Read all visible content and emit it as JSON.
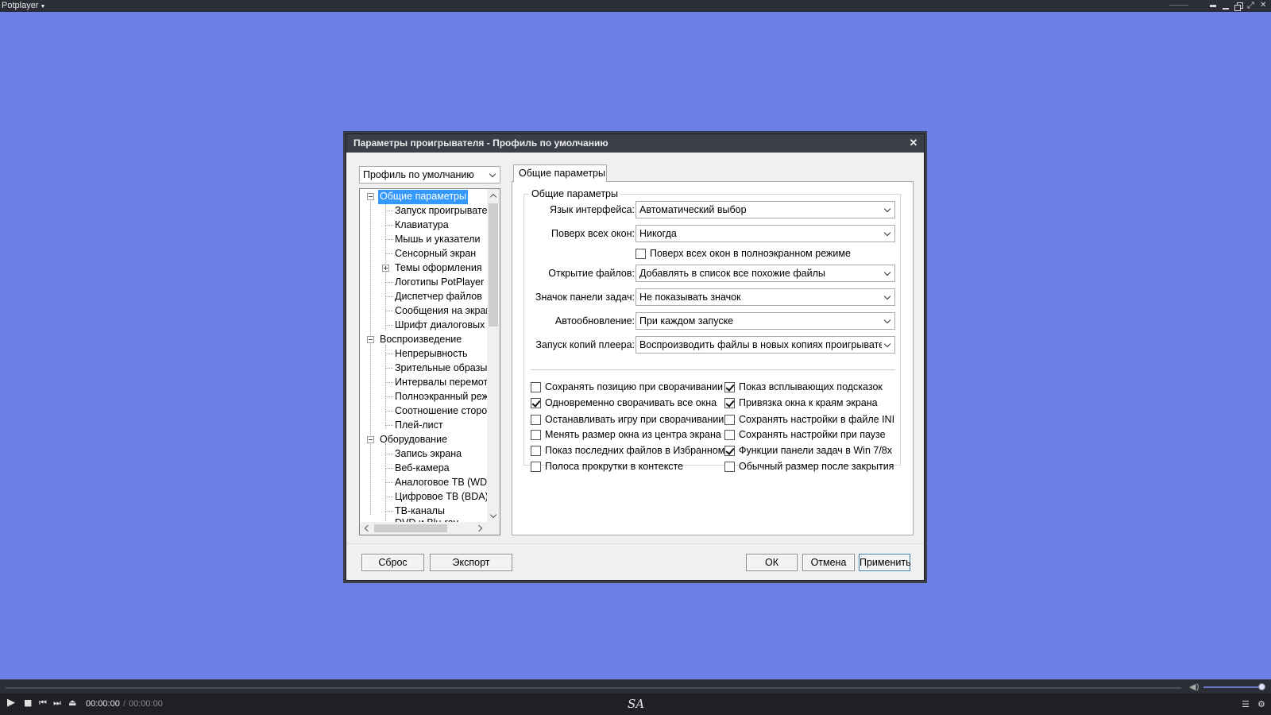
{
  "app": {
    "title": "Potplayer"
  },
  "dialog": {
    "title": "Параметры проигрывателя - Профиль по умолчанию",
    "profile_select": "Профиль по умолчанию",
    "tree": [
      "Общие параметры",
      "Запуск проигрывател",
      "Клавиатура",
      "Мышь и указатели",
      "Сенсорный экран",
      "Темы оформления",
      "Логотипы PotPlayer",
      "Диспетчер файлов",
      "Сообщения на экран",
      "Шрифт диалоговых о",
      "Воспроизведение",
      "Непрерывность",
      "Зрительные образы",
      "Интервалы перемотк",
      "Полноэкранный реж",
      "Соотношение сторон",
      "Плей-лист",
      "Оборудование",
      "Запись экрана",
      "Веб-камера",
      "Аналоговое ТВ (WDM",
      "Цифровое ТВ (BDA)",
      "ТВ-каналы",
      "DVD и Blu-ray"
    ],
    "tab_label": "Общие параметры",
    "group_title": "Общие параметры",
    "fields": {
      "language_label": "Язык интерфейса:",
      "language_value": "Автоматический выбор",
      "ontop_label": "Поверх всех окон:",
      "ontop_value": "Никогда",
      "ontop_fullscreen": "Поверх всех окон в полноэкранном режиме",
      "open_files_label": "Открытие файлов:",
      "open_files_value": "Добавлять в список все похожие файлы",
      "tray_label": "Значок панели задач:",
      "tray_value": "Не показывать значок",
      "autoupdate_label": "Автообновление:",
      "autoupdate_value": "При каждом запуске",
      "instances_label": "Запуск копий плеера:",
      "instances_value": "Воспроизводить файлы в новых копиях проигрывателя"
    },
    "checkboxes": {
      "save_pos": {
        "label": "Сохранять позицию при сворачивании",
        "checked": false
      },
      "tooltips": {
        "label": "Показ всплывающих подсказок",
        "checked": true
      },
      "minimize_all": {
        "label": "Одновременно сворачивать все окна",
        "checked": true
      },
      "snap_edges": {
        "label": "Привязка окна к краям экрана",
        "checked": true
      },
      "pause_game": {
        "label": "Останавливать игру при сворачивании",
        "checked": false
      },
      "save_ini": {
        "label": "Сохранять настройки в файле INI",
        "checked": false
      },
      "resize_center": {
        "label": "Менять размер окна из центра экрана",
        "checked": false
      },
      "save_on_pause": {
        "label": "Сохранять настройки при паузе",
        "checked": false
      },
      "recent_favorites": {
        "label": "Показ последних файлов в Избранном",
        "checked": false
      },
      "taskbar_win7": {
        "label": "Функции панели задач в Win 7/8x",
        "checked": true
      },
      "context_scroll": {
        "label": "Полоса прокрутки в контексте",
        "checked": false
      },
      "normal_size": {
        "label": "Обычный размер после закрытия",
        "checked": false
      }
    },
    "buttons": {
      "reset": "Сброс",
      "export": "Экспорт",
      "ok": "ОК",
      "cancel": "Отмена",
      "apply": "Применить"
    }
  },
  "player": {
    "time_current": "00:00:00",
    "time_separator": "/",
    "time_total": "00:00:00",
    "logo": "SA",
    "volume": 0.95,
    "seek": 0.0
  },
  "colors": {
    "background": "#6c7fe6",
    "selection": "#3399ff",
    "titlebar": "#3b3f49"
  }
}
